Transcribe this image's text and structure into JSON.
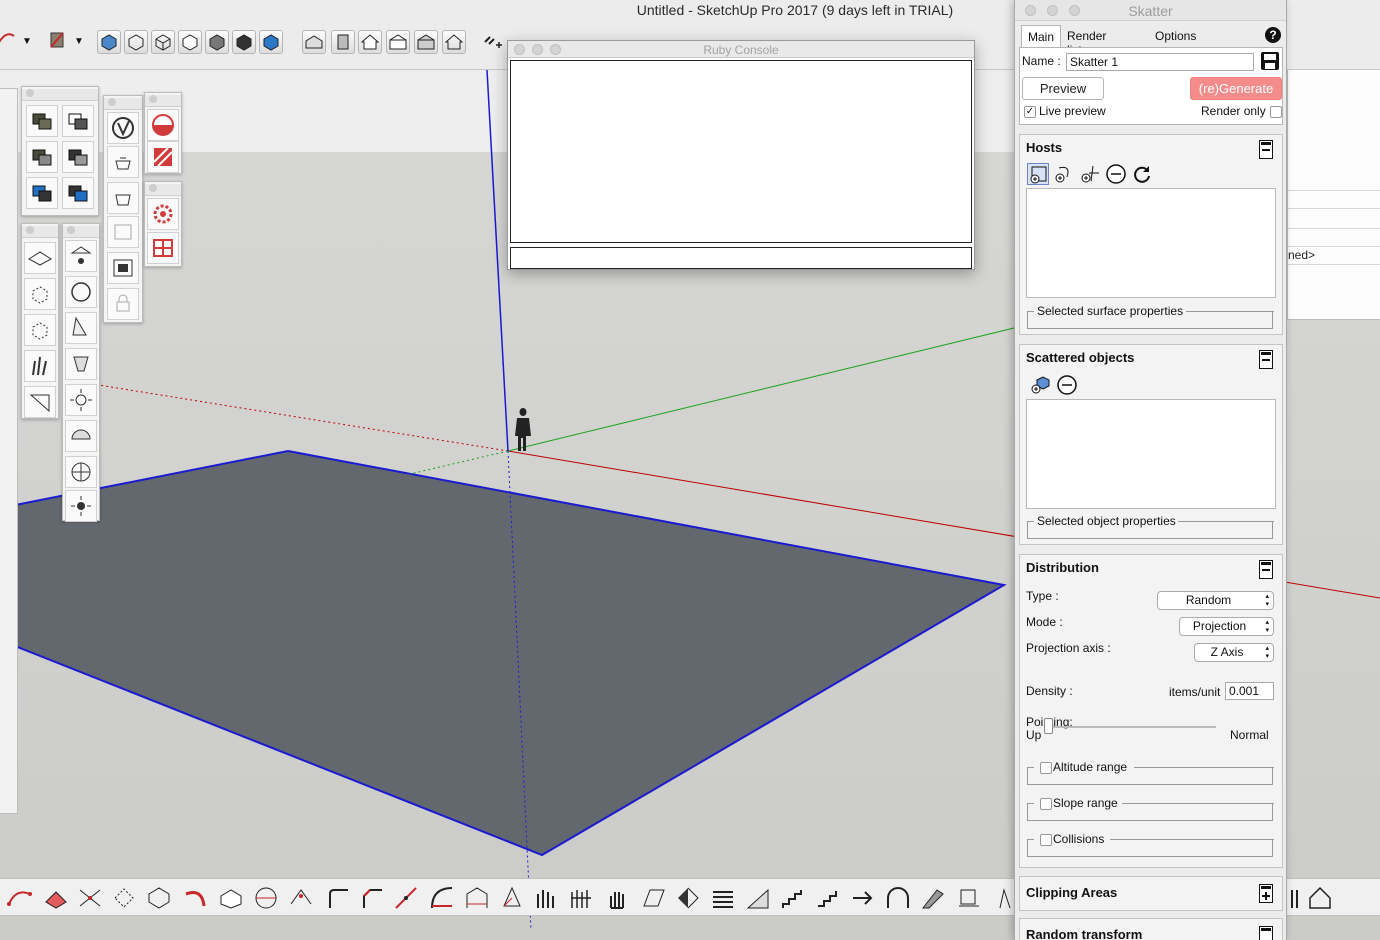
{
  "window": {
    "title": "Untitled - SketchUp Pro 2017 (9 days left in TRIAL)"
  },
  "ruby_console": {
    "title": "Ruby Console"
  },
  "background_panel": {
    "partial_text": "ned>"
  },
  "skatter": {
    "title": "Skatter",
    "tabs": [
      "Main",
      "Render list",
      "Options"
    ],
    "help_label": "?",
    "name_label": "Name :",
    "name_value": "Skatter 1",
    "preview_label": "Preview",
    "generate_label": "(re)Generate",
    "live_preview_label": "Live preview",
    "render_only_label": "Render only",
    "hosts": {
      "title": "Hosts",
      "group_label": "Selected surface properties"
    },
    "scattered": {
      "title": "Scattered objects",
      "group_label": "Selected object properties"
    },
    "distribution": {
      "title": "Distribution",
      "type_label": "Type :",
      "type_value": "Random",
      "mode_label": "Mode :",
      "mode_value": "Projection",
      "axis_label": "Projection axis :",
      "axis_value": "Z Axis",
      "density_label": "Density :",
      "density_unit": "items/unit",
      "density_value": "0.001",
      "pointing_label": "Pointing:",
      "pointing_min": "Up",
      "pointing_max": "Normal",
      "pointing_value": 0,
      "altitude_label": "Altitude range",
      "slope_label": "Slope range",
      "collisions_label": "Collisions"
    },
    "clipping": {
      "title": "Clipping Areas"
    },
    "random_transform": {
      "title": "Random transform"
    }
  },
  "colors": {
    "accent_red": "#f48c8c",
    "axis_red": "#c00000",
    "axis_green": "#1aa01a",
    "axis_blue": "#1a1ad0",
    "face_fill": "#63686f"
  }
}
